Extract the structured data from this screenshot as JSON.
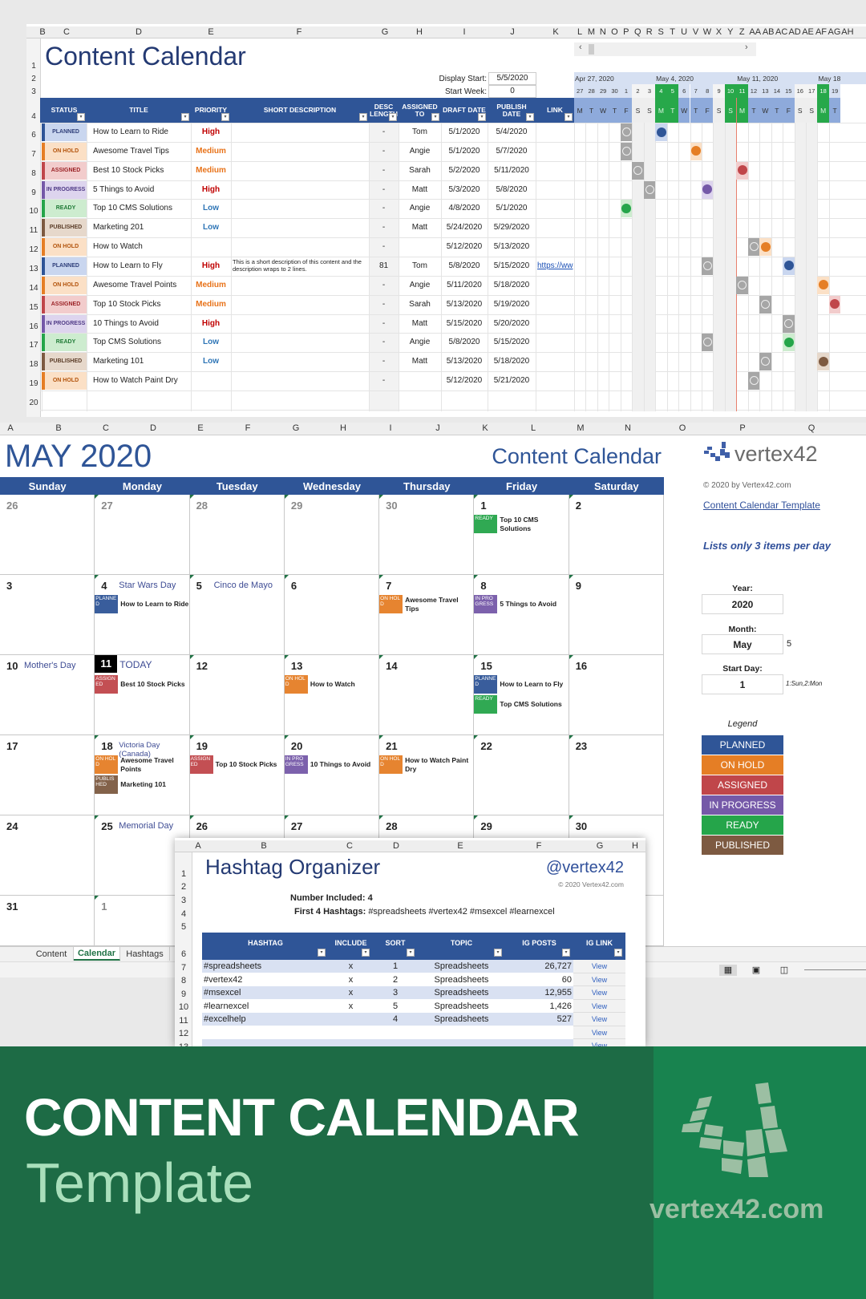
{
  "content_sheet": {
    "title": "Content Calendar",
    "column_letters": [
      "B",
      "C",
      "D",
      "E",
      "F",
      "G",
      "H",
      "I",
      "J",
      "K",
      "L",
      "M",
      "N",
      "O",
      "P",
      "Q",
      "R",
      "S",
      "T",
      "U",
      "V",
      "W",
      "X",
      "Y",
      "Z",
      "AA",
      "AB",
      "AC",
      "AD",
      "AE",
      "AF",
      "AG",
      "AH"
    ],
    "display_start_label": "Display Start:",
    "display_start": "5/5/2020",
    "start_week_label": "Start Week:",
    "start_week": "0",
    "headers": [
      "STATUS",
      "TITLE",
      "PRIORITY",
      "SHORT DESCRIPTION",
      "DESC LENGTH",
      "ASSIGNED TO",
      "DRAFT DATE",
      "PUBLISH DATE",
      "LINK"
    ],
    "row_numbers": [
      "1",
      "2",
      "3",
      "4",
      "6",
      "7",
      "8",
      "9",
      "10",
      "11",
      "12",
      "13",
      "14",
      "15",
      "16",
      "17",
      "18",
      "19",
      "20"
    ],
    "rows": [
      {
        "status": "PLANNED",
        "title": "How to Learn to Ride",
        "priority": "High",
        "desc": "",
        "len": "-",
        "assigned": "Tom",
        "draft": "5/1/2020",
        "publish": "5/4/2020",
        "link": ""
      },
      {
        "status": "ON HOLD",
        "title": "Awesome Travel Tips",
        "priority": "Medium",
        "desc": "",
        "len": "-",
        "assigned": "Angie",
        "draft": "5/1/2020",
        "publish": "5/7/2020",
        "link": ""
      },
      {
        "status": "ASSIGNED",
        "title": "Best 10 Stock Picks",
        "priority": "Medium",
        "desc": "",
        "len": "-",
        "assigned": "Sarah",
        "draft": "5/2/2020",
        "publish": "5/11/2020",
        "link": ""
      },
      {
        "status": "IN PROGRESS",
        "title": "5 Things to Avoid",
        "priority": "High",
        "desc": "",
        "len": "-",
        "assigned": "Matt",
        "draft": "5/3/2020",
        "publish": "5/8/2020",
        "link": ""
      },
      {
        "status": "READY",
        "title": "Top 10 CMS Solutions",
        "priority": "Low",
        "desc": "",
        "len": "-",
        "assigned": "Angie",
        "draft": "4/8/2020",
        "publish": "5/1/2020",
        "link": ""
      },
      {
        "status": "PUBLISHED",
        "title": "Marketing 201",
        "priority": "Low",
        "desc": "",
        "len": "-",
        "assigned": "Matt",
        "draft": "5/24/2020",
        "publish": "5/29/2020",
        "link": ""
      },
      {
        "status": "ON HOLD",
        "title": "How to Watch",
        "priority": "",
        "desc": "",
        "len": "-",
        "assigned": "",
        "draft": "5/12/2020",
        "publish": "5/13/2020",
        "link": ""
      },
      {
        "status": "PLANNED",
        "title": "How to Learn to Fly",
        "priority": "High",
        "desc": "This is a short description of this content and the description wraps to 2 lines.",
        "len": "81",
        "assigned": "Tom",
        "draft": "5/8/2020",
        "publish": "5/15/2020",
        "link": "https://ww"
      },
      {
        "status": "ON HOLD",
        "title": "Awesome Travel Points",
        "priority": "Medium",
        "desc": "",
        "len": "-",
        "assigned": "Angie",
        "draft": "5/11/2020",
        "publish": "5/18/2020",
        "link": ""
      },
      {
        "status": "ASSIGNED",
        "title": "Top 10 Stock Picks",
        "priority": "Medium",
        "desc": "",
        "len": "-",
        "assigned": "Sarah",
        "draft": "5/13/2020",
        "publish": "5/19/2020",
        "link": ""
      },
      {
        "status": "IN PROGRESS",
        "title": "10 Things to Avoid",
        "priority": "High",
        "desc": "",
        "len": "-",
        "assigned": "Matt",
        "draft": "5/15/2020",
        "publish": "5/20/2020",
        "link": ""
      },
      {
        "status": "READY",
        "title": "Top CMS Solutions",
        "priority": "Low",
        "desc": "",
        "len": "-",
        "assigned": "Angie",
        "draft": "5/8/2020",
        "publish": "5/15/2020",
        "link": ""
      },
      {
        "status": "PUBLISHED",
        "title": "Marketing 101",
        "priority": "Low",
        "desc": "",
        "len": "-",
        "assigned": "Matt",
        "draft": "5/13/2020",
        "publish": "5/18/2020",
        "link": ""
      },
      {
        "status": "ON HOLD",
        "title": "How to Watch Paint Dry",
        "priority": "",
        "desc": "",
        "len": "-",
        "assigned": "",
        "draft": "5/12/2020",
        "publish": "5/21/2020",
        "link": ""
      }
    ],
    "gantt": {
      "scroll_left": "‹",
      "scroll_right": "›",
      "week_labels": [
        "Apr 27, 2020",
        "May 4, 2020",
        "May 11, 2020",
        "May 18"
      ],
      "days": [
        "27",
        "28",
        "29",
        "30",
        "1",
        "2",
        "3",
        "4",
        "5",
        "6",
        "7",
        "8",
        "9",
        "10",
        "11",
        "12",
        "13",
        "14",
        "15",
        "16",
        "17",
        "18",
        "19"
      ],
      "weekdays": [
        "M",
        "T",
        "W",
        "T",
        "F",
        "S",
        "S",
        "M",
        "T",
        "W",
        "T",
        "F",
        "S",
        "S",
        "M",
        "T",
        "W",
        "T",
        "F",
        "S",
        "S",
        "M",
        "T"
      ],
      "highlight_days": [
        "4",
        "5",
        "10",
        "11",
        "18"
      ],
      "today": "11"
    }
  },
  "calendar_sheet": {
    "column_letters": [
      "A",
      "B",
      "C",
      "D",
      "E",
      "F",
      "G",
      "H",
      "I",
      "J",
      "K",
      "L",
      "M",
      "N",
      "O",
      "P",
      "Q"
    ],
    "month_title": "MAY 2020",
    "app_title": "Content Calendar",
    "weekdays": [
      "Sunday",
      "Monday",
      "Tuesday",
      "Wednesday",
      "Thursday",
      "Friday",
      "Saturday"
    ],
    "weeks": [
      [
        {
          "n": "26",
          "other": true
        },
        {
          "n": "27",
          "other": true
        },
        {
          "n": "28",
          "other": true
        },
        {
          "n": "29",
          "other": true
        },
        {
          "n": "30",
          "other": true
        },
        {
          "n": "1",
          "items": [
            {
              "status": "READY",
              "title": "Top 10 CMS Solutions"
            }
          ]
        },
        {
          "n": "2"
        }
      ],
      [
        {
          "n": "3"
        },
        {
          "n": "4",
          "hol": "Star Wars Day",
          "items": [
            {
              "status": "PLANNED",
              "title": "How to Learn to Ride"
            }
          ]
        },
        {
          "n": "5",
          "hol": "Cinco de Mayo"
        },
        {
          "n": "6"
        },
        {
          "n": "7",
          "items": [
            {
              "status": "ON HOLD",
              "title": "Awesome Travel Tips"
            }
          ]
        },
        {
          "n": "8",
          "items": [
            {
              "status": "IN PROGRESS",
              "title": "5 Things to Avoid"
            }
          ]
        },
        {
          "n": "9"
        }
      ],
      [
        {
          "n": "10",
          "hol": "Mother's Day"
        },
        {
          "n": "11",
          "hol": "TODAY",
          "today": true,
          "items": [
            {
              "status": "ASSIGNED",
              "title": "Best 10 Stock Picks"
            }
          ]
        },
        {
          "n": "12"
        },
        {
          "n": "13",
          "items": [
            {
              "status": "ON HOLD",
              "title": "How to Watch"
            }
          ]
        },
        {
          "n": "14"
        },
        {
          "n": "15",
          "items": [
            {
              "status": "PLANNED",
              "title": "How to Learn to Fly"
            },
            {
              "status": "READY",
              "title": "Top CMS Solutions"
            }
          ]
        },
        {
          "n": "16"
        }
      ],
      [
        {
          "n": "17"
        },
        {
          "n": "18",
          "hol": "Victoria Day (Canada)",
          "items": [
            {
              "status": "ON HOLD",
              "title": "Awesome Travel Points"
            },
            {
              "status": "PUBLISHED",
              "title": "Marketing 101"
            }
          ]
        },
        {
          "n": "19",
          "items": [
            {
              "status": "ASSIGNED",
              "title": "Top 10 Stock Picks"
            }
          ]
        },
        {
          "n": "20",
          "items": [
            {
              "status": "IN PROGRESS",
              "title": "10 Things to Avoid"
            }
          ]
        },
        {
          "n": "21",
          "items": [
            {
              "status": "ON HOLD",
              "title": "How to Watch Paint Dry"
            }
          ]
        },
        {
          "n": "22"
        },
        {
          "n": "23"
        }
      ],
      [
        {
          "n": "24"
        },
        {
          "n": "25",
          "hol": "Memorial Day"
        },
        {
          "n": "26"
        },
        {
          "n": "27"
        },
        {
          "n": "28"
        },
        {
          "n": "29"
        },
        {
          "n": "30"
        }
      ],
      [
        {
          "n": "31"
        },
        {
          "n": "1",
          "other": true
        },
        {
          "n": ""
        },
        {
          "n": ""
        },
        {
          "n": ""
        },
        {
          "n": ""
        },
        {
          "n": ""
        }
      ]
    ],
    "side": {
      "logo_text": "vertex42",
      "copyright": "© 2020 by Vertex42.com",
      "template_link": "Content Calendar Template",
      "note": "Lists only 3 items per day",
      "year_label": "Year:",
      "year": "2020",
      "month_label": "Month:",
      "month": "May",
      "month_num": "5",
      "start_day_label": "Start Day:",
      "start_day": "1",
      "start_day_hint": "1:Sun,2:Mon",
      "legend_title": "Legend",
      "legend": [
        "PLANNED",
        "ON HOLD",
        "ASSIGNED",
        "IN PROGRESS",
        "READY",
        "PUBLISHED"
      ]
    },
    "tabs": [
      "Content",
      "Calendar",
      "Hashtags"
    ],
    "active_tab": "Calendar"
  },
  "hashtag_sheet": {
    "column_letters": [
      "A",
      "B",
      "C",
      "D",
      "E",
      "F",
      "G",
      "H"
    ],
    "row_numbers": [
      "1",
      "2",
      "3",
      "4",
      "5",
      "6",
      "7",
      "8",
      "9",
      "10",
      "11",
      "12",
      "13"
    ],
    "title": "Hashtag Organizer",
    "handle": "@vertex42",
    "copyright": "© 2020 Vertex42.com",
    "number_included_label": "Number Included:",
    "number_included": "4",
    "first_label": "First 4 Hashtags:",
    "first_hashtags": "#spreadsheets #vertex42 #msexcel #learnexcel",
    "headers": [
      "HASHTAG",
      "INCLUDE",
      "SORT",
      "TOPIC",
      "IG  POSTS",
      "IG LINK"
    ],
    "rows": [
      {
        "tag": "#spreadsheets",
        "inc": "x",
        "sort": "1",
        "topic": "Spreadsheets",
        "posts": "26,727",
        "link": "View"
      },
      {
        "tag": "#vertex42",
        "inc": "x",
        "sort": "2",
        "topic": "Spreadsheets",
        "posts": "60",
        "link": "View"
      },
      {
        "tag": "#msexcel",
        "inc": "x",
        "sort": "3",
        "topic": "Spreadsheets",
        "posts": "12,955",
        "link": "View"
      },
      {
        "tag": "#learnexcel",
        "inc": "x",
        "sort": "5",
        "topic": "Spreadsheets",
        "posts": "1,426",
        "link": "View"
      },
      {
        "tag": "#excelhelp",
        "inc": "",
        "sort": "4",
        "topic": "Spreadsheets",
        "posts": "527",
        "link": "View"
      },
      {
        "tag": "",
        "inc": "",
        "sort": "",
        "topic": "",
        "posts": "",
        "link": "View"
      },
      {
        "tag": "",
        "inc": "",
        "sort": "",
        "topic": "",
        "posts": "",
        "link": "View"
      }
    ]
  },
  "banner": {
    "title": "CONTENT CALENDAR",
    "subtitle": "Template",
    "site": "vertex42.com"
  },
  "colors": {
    "header_blue": "#2f5597",
    "status": {
      "PLANNED": {
        "solid": "#2f5597",
        "tint": "#c9d6ef",
        "text": "#2f3f7a"
      },
      "ON HOLD": {
        "solid": "#e57e25",
        "tint": "#fbe0c6",
        "text": "#b3540d"
      },
      "ASSIGNED": {
        "solid": "#c0464a",
        "tint": "#f2cccc",
        "text": "#9b2226"
      },
      "IN PROGRESS": {
        "solid": "#7559a8",
        "tint": "#ddd4ee",
        "text": "#4f3a86"
      },
      "READY": {
        "solid": "#25a54a",
        "tint": "#cdeccf",
        "text": "#1f7a36"
      },
      "PUBLISHED": {
        "solid": "#7d5a41",
        "tint": "#e6d8cb",
        "text": "#5b3d28"
      }
    },
    "priority": {
      "High": "#c00000",
      "Medium": "#e8731a",
      "Low": "#2e75b6"
    },
    "banner_dark": "#1d6b45",
    "banner_light": "#18834f"
  }
}
